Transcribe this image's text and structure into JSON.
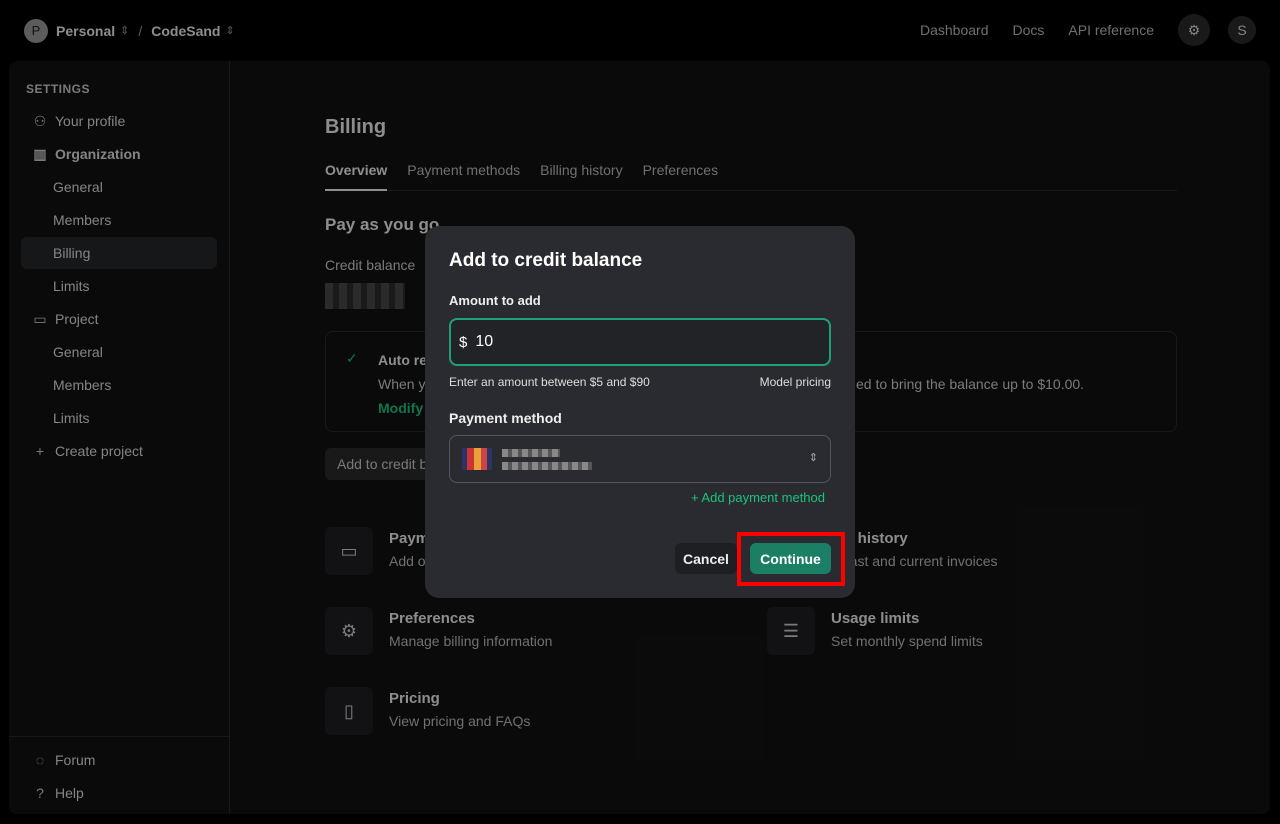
{
  "topbar": {
    "avatar": "P",
    "org": "Personal",
    "project": "CodeSand",
    "nav": [
      "Dashboard",
      "Docs",
      "API reference"
    ],
    "user_avatar": "S"
  },
  "sidebar": {
    "heading": "SETTINGS",
    "items": [
      "Your profile",
      "Organization",
      "General",
      "Members",
      "Billing",
      "Limits",
      "Project",
      "General",
      "Members",
      "Limits",
      "Create project"
    ],
    "footer": [
      "Forum",
      "Help"
    ]
  },
  "main": {
    "title": "Billing",
    "tabs": [
      "Overview",
      "Payment methods",
      "Billing history",
      "Preferences"
    ],
    "section": "Pay as you go",
    "credit_label": "Credit balance",
    "auto_title": "Auto re",
    "auto_desc_start": "When y",
    "auto_desc_end": "ed to bring the balance up to $10.00.",
    "modify": "Modify",
    "add_button": "Add to credit b",
    "cards": [
      {
        "title": "Paym",
        "desc": "Add o"
      },
      {
        "title": "ing history",
        "desc": "v past and current invoices"
      },
      {
        "title": "Preferences",
        "desc": "Manage billing information"
      },
      {
        "title": "Usage limits",
        "desc": "Set monthly spend limits"
      },
      {
        "title": "Pricing",
        "desc": "View pricing and FAQs"
      }
    ]
  },
  "modal": {
    "title": "Add to credit balance",
    "amount_label": "Amount to add",
    "currency": "$",
    "amount": "10",
    "hint": "Enter an amount between $5 and $90",
    "pricing_link": "Model pricing",
    "payment_label": "Payment method",
    "add_payment": "+ Add payment method",
    "cancel": "Cancel",
    "continue": "Continue"
  },
  "colors": {
    "accent": "#1a7f64",
    "highlight": "#ff0000"
  }
}
